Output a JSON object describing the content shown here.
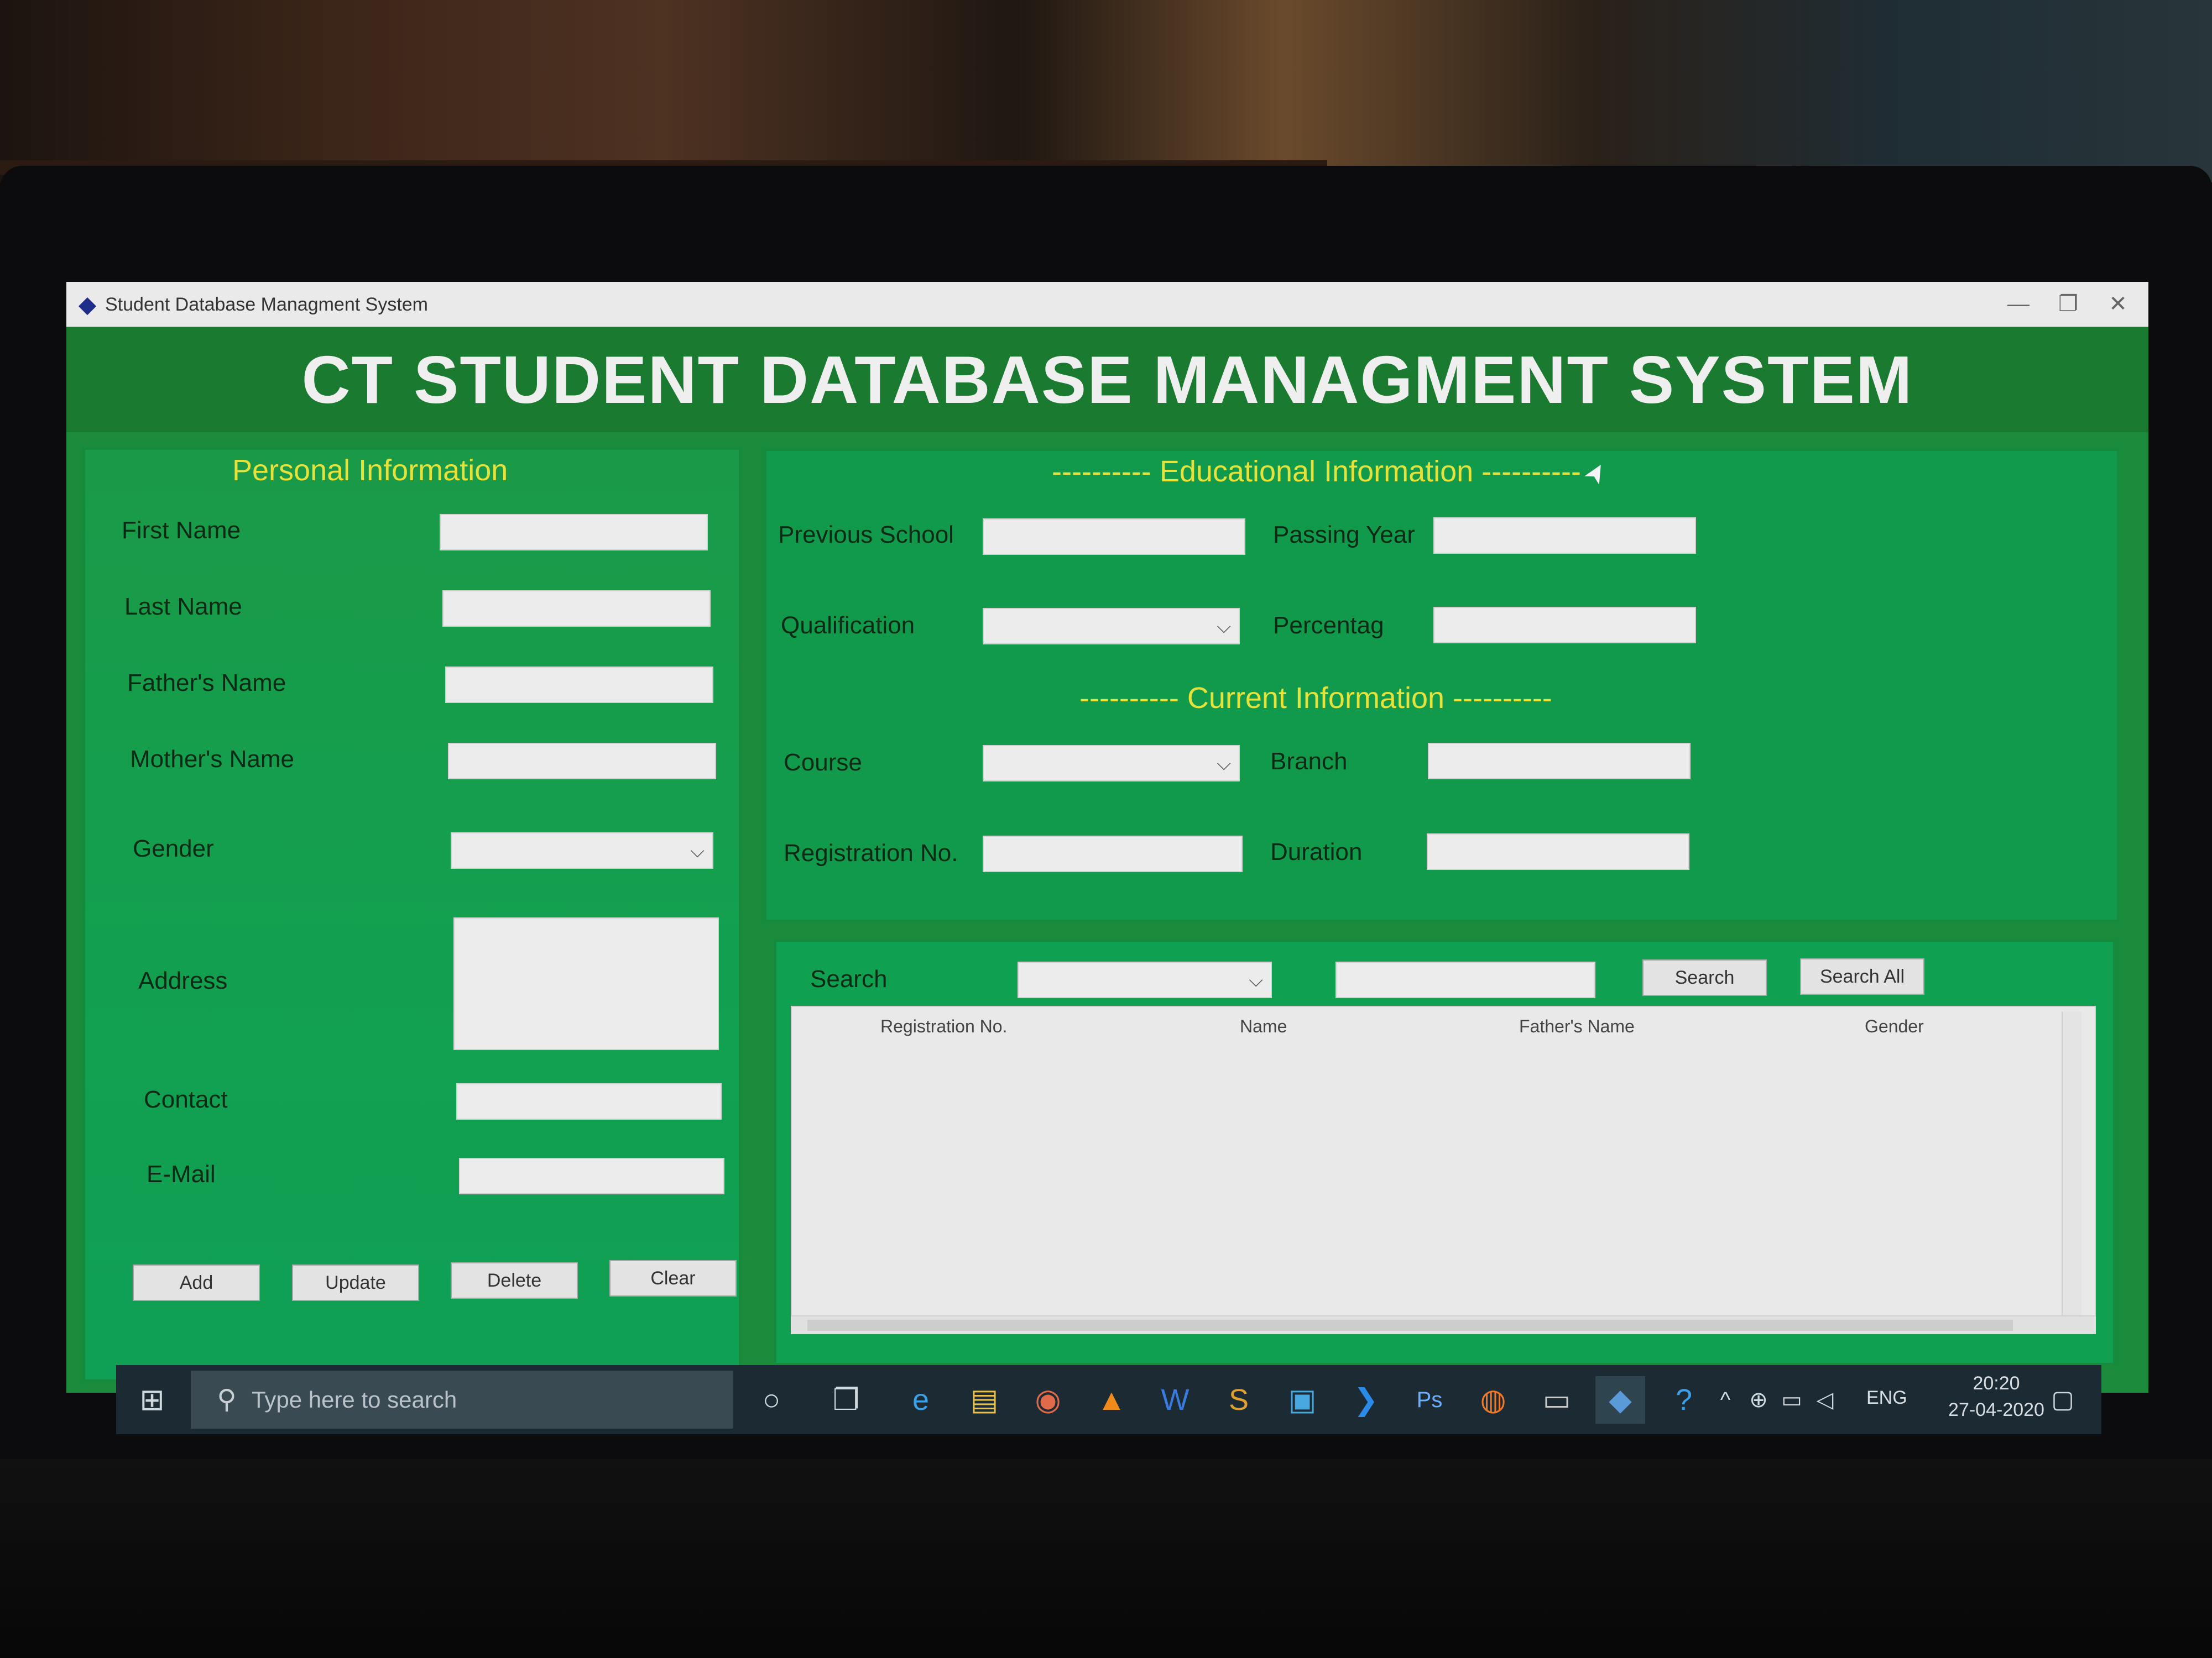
{
  "window": {
    "title": "Student Database Managment System",
    "minimize": "—",
    "maximize": "❐",
    "close": "✕"
  },
  "banner": {
    "title": "CT STUDENT DATABASE MANAGMENT SYSTEM"
  },
  "personal": {
    "heading": "Personal Information",
    "first_name": "First Name",
    "last_name": "Last Name",
    "fathers_name": "Father's Name",
    "mothers_name": "Mother's Name",
    "gender": "Gender",
    "address": "Address",
    "contact": "Contact",
    "email": "E-Mail",
    "buttons": {
      "add": "Add",
      "update": "Update",
      "delete": "Delete",
      "clear": "Clear"
    }
  },
  "education": {
    "heading": "---------- Educational Information ----------",
    "previous_school": "Previous School",
    "passing_year": "Passing Year",
    "qualification": "Qualification",
    "percentage": "Percentag"
  },
  "current": {
    "heading": "---------- Current Information ----------",
    "course": "Course",
    "branch": "Branch",
    "registration_no": "Registration No.",
    "duration": "Duration"
  },
  "search": {
    "label": "Search",
    "search_button": "Search",
    "search_all_button": "Search All",
    "columns": [
      "Registration No.",
      "Name",
      "Father's Name",
      "Gender"
    ]
  },
  "taskbar": {
    "search_placeholder": "Type here to search",
    "language": "ENG",
    "time": "20:20",
    "date": "27-04-2020"
  },
  "icons": {
    "combo_arrow": "⌵",
    "windows": "⊞",
    "search": "⚲",
    "cortana": "○",
    "task_view": "❐",
    "edge": "e",
    "explorer": "▤",
    "chrome": "◉",
    "vlc": "▲",
    "word": "W",
    "sublime": "S",
    "remote": "▣",
    "vscode": "❯",
    "photoshop": "Ps",
    "firefox": "◍",
    "terminal": "▭",
    "python": "◆",
    "help": "?",
    "tray_up": "^",
    "network": "⊕",
    "battery": "▭",
    "volume": "◁",
    "notification": "▢",
    "cursor": "➤"
  }
}
